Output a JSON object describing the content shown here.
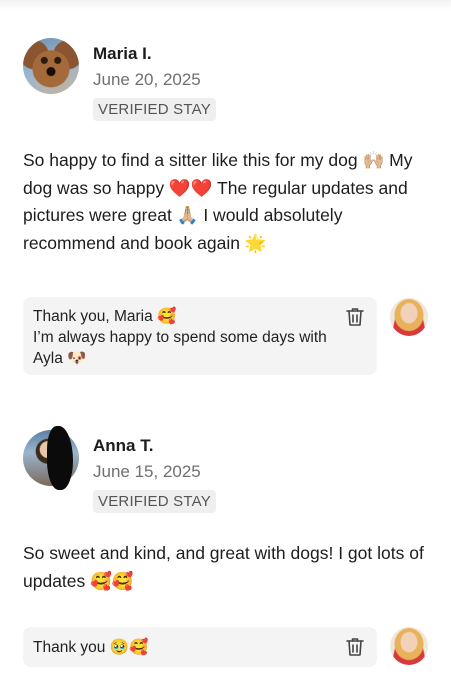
{
  "reviews": [
    {
      "reviewer_name": "Maria I.",
      "date": "June 20, 2025",
      "badge": "VERIFIED STAY",
      "text": "So happy to find a sitter like this for my dog 🙌🏼 My dog was so happy ❤️❤️ The regular updates and pictures were great 🙏🏼 I would absolutely recommend and book again 🌟",
      "reply": "Thank you, Maria 🥰\nI’m always happy to spend some days with Ayla 🐶"
    },
    {
      "reviewer_name": "Anna T.",
      "date": "June 15, 2025",
      "badge": "VERIFIED STAY",
      "text": "So sweet and kind, and great with dogs! I got lots of updates 🥰🥰",
      "reply": "Thank you 🥹🥰"
    }
  ],
  "icons": {
    "delete": "trash-icon",
    "reviewer_avatar": "avatar",
    "host_avatar": "avatar"
  },
  "colors": {
    "badge_bg": "#efefef",
    "reply_bg": "#f4f4f4",
    "date_text": "#6f6f6f"
  }
}
